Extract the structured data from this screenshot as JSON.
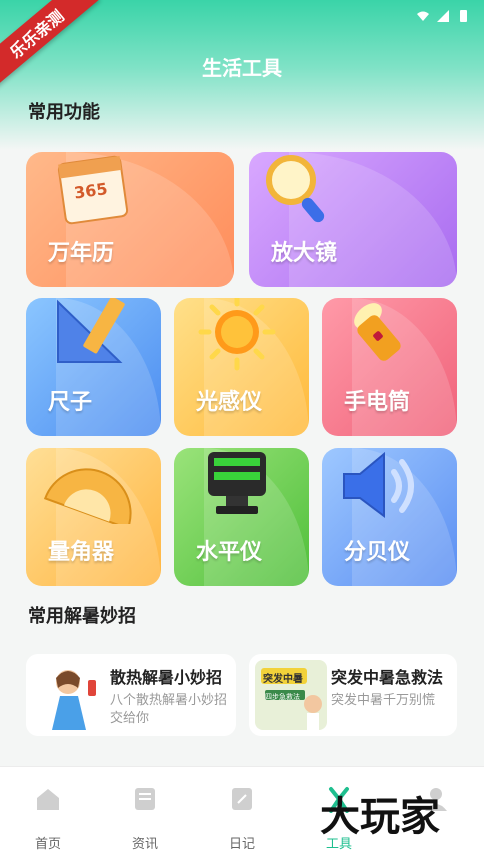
{
  "ribbon": "乐乐亲测",
  "header": {
    "title": "生活工具"
  },
  "sections": {
    "common": "常用功能",
    "tips": "常用解暑妙招"
  },
  "tools": [
    {
      "label": "万年历",
      "icon": "calendar-icon",
      "badge": "365"
    },
    {
      "label": "放大镜",
      "icon": "magnifier-icon"
    },
    {
      "label": "尺子",
      "icon": "ruler-icon"
    },
    {
      "label": "光感仪",
      "icon": "sun-icon"
    },
    {
      "label": "手电筒",
      "icon": "flashlight-icon"
    },
    {
      "label": "量角器",
      "icon": "protractor-icon"
    },
    {
      "label": "水平仪",
      "icon": "laser-level-icon"
    },
    {
      "label": "分贝仪",
      "icon": "speaker-icon"
    }
  ],
  "tips": [
    {
      "title": "散热解暑小妙招",
      "desc": "八个散热解暑小妙招交给你"
    },
    {
      "title": "突发中暑急救法",
      "desc": "突发中暑千万别慌",
      "thumb_text": "突发中暑",
      "thumb_sub": "四步急救法"
    }
  ],
  "tabs": [
    {
      "label": "首页",
      "icon": "home-icon"
    },
    {
      "label": "资讯",
      "icon": "news-icon"
    },
    {
      "label": "日记",
      "icon": "diary-icon"
    },
    {
      "label": "工具",
      "icon": "tools-icon",
      "active": true
    },
    {
      "label": "",
      "icon": "profile-icon"
    }
  ],
  "watermark": "大玩家",
  "colors": {
    "accent": "#2fcf9f",
    "active_tab": "#1fbf8f"
  }
}
